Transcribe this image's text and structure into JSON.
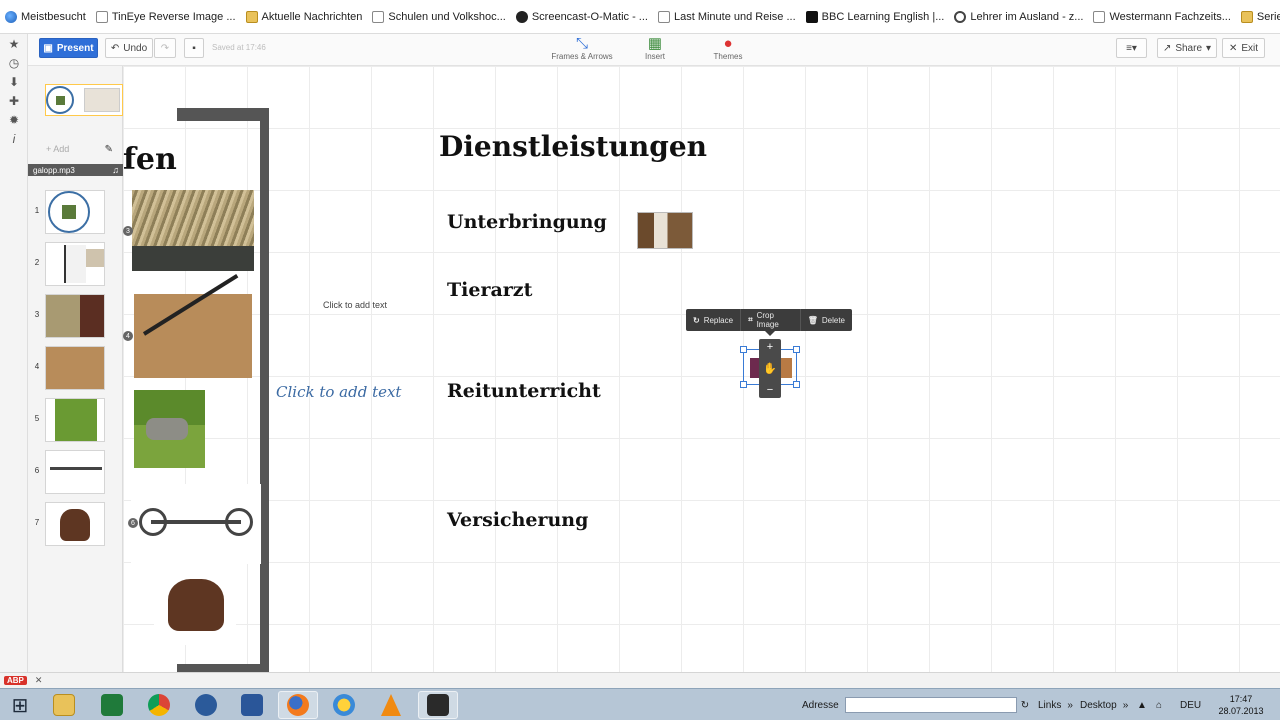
{
  "bookmarks": [
    {
      "label": "Meistbesucht",
      "icon": "globe-icon"
    },
    {
      "label": "TinEye Reverse Image ...",
      "icon": "tineye-icon"
    },
    {
      "label": "Aktuelle Nachrichten",
      "icon": "folder-icon"
    },
    {
      "label": "Schulen und Volkshoc...",
      "icon": "page-icon"
    },
    {
      "label": "Screencast-O-Matic - ...",
      "icon": "som-icon"
    },
    {
      "label": "Last Minute und Reise ...",
      "icon": "page-icon"
    },
    {
      "label": "BBC Learning English |...",
      "icon": "bbc-icon"
    },
    {
      "label": "Lehrer im Ausland - z...",
      "icon": "eye-icon"
    },
    {
      "label": "Westermann Fachzeits...",
      "icon": "page-icon"
    },
    {
      "label": "Serie: Wirtschaft für Ki...",
      "icon": "folder-icon"
    }
  ],
  "toolbar": {
    "present_label": "Present",
    "undo_label": "Undo",
    "saved_text": "Saved at 17:46",
    "tools": [
      {
        "label": "Frames & Arrows",
        "icon": "frames-arrows-icon"
      },
      {
        "label": "Insert",
        "icon": "insert-icon"
      },
      {
        "label": "Themes",
        "icon": "themes-icon"
      }
    ],
    "share_label": "Share",
    "exit_label": "Exit"
  },
  "panel": {
    "add_label": "+ Add",
    "audio_label": "galopp.mp3",
    "slides": [
      "1",
      "2",
      "3",
      "4",
      "5",
      "6",
      "7"
    ]
  },
  "canvas": {
    "left_title": "fen",
    "title": "Dienstleistungen",
    "headings": [
      "Unterbringung",
      "Tierarzt",
      "Reitunterricht",
      "Versicherung"
    ],
    "placeholder_small": "Click to add text",
    "placeholder_large": "Click to add text",
    "path_numbers": [
      "3",
      "4",
      "6"
    ]
  },
  "image_menu": {
    "replace_label": "Replace",
    "crop_label": "Crop Image",
    "delete_label": "Delete"
  },
  "taskbar": {
    "address_label": "Adresse",
    "links_label": "Links",
    "desktop_label": "Desktop",
    "language": "DEU",
    "time": "17:47",
    "date": "28.07.2013"
  },
  "colors": {
    "accent": "#2f6fd8",
    "frame_bar": "#555555",
    "placeholder_text": "#3b6aa3",
    "selection": "#3a7bd5"
  }
}
